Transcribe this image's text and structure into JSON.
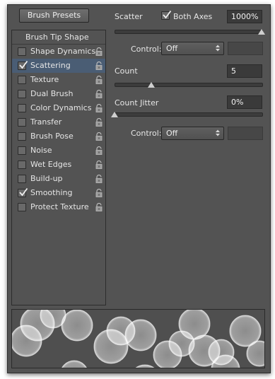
{
  "presets_button": {
    "label": "Brush Presets"
  },
  "sidebar": {
    "header": "Brush Tip Shape",
    "items": [
      {
        "label": "Shape Dynamics",
        "checked": false,
        "selected": false
      },
      {
        "label": "Scattering",
        "checked": true,
        "selected": true
      },
      {
        "label": "Texture",
        "checked": false,
        "selected": false
      },
      {
        "label": "Dual Brush",
        "checked": false,
        "selected": false
      },
      {
        "label": "Color Dynamics",
        "checked": false,
        "selected": false
      },
      {
        "label": "Transfer",
        "checked": false,
        "selected": false
      },
      {
        "label": "Brush Pose",
        "checked": false,
        "selected": false
      },
      {
        "label": "Noise",
        "checked": false,
        "selected": false
      },
      {
        "label": "Wet Edges",
        "checked": false,
        "selected": false
      },
      {
        "label": "Build-up",
        "checked": false,
        "selected": false
      },
      {
        "label": "Smoothing",
        "checked": true,
        "selected": false
      },
      {
        "label": "Protect Texture",
        "checked": false,
        "selected": false
      }
    ]
  },
  "scatter": {
    "label": "Scatter",
    "both_axes_label": "Both Axes",
    "both_axes_checked": true,
    "value": "1000%",
    "slider_fraction": 1.0,
    "control_label": "Control:",
    "control_value": "Off"
  },
  "count": {
    "label": "Count",
    "value": "5",
    "slider_fraction": 0.25
  },
  "count_jitter": {
    "label": "Count Jitter",
    "value": "0%",
    "slider_fraction": 0.0,
    "control_label": "Control:",
    "control_value": "Off"
  },
  "colors": {
    "panel": "#535353",
    "selection": "#4a5d74",
    "field": "#3a3a3a"
  }
}
